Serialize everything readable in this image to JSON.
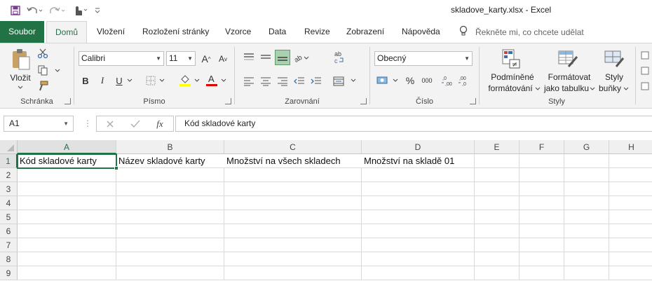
{
  "window": {
    "title": "skladove_karty.xlsx  -  Excel"
  },
  "colors": {
    "accent": "#217346"
  },
  "qat": {
    "icons": [
      "save-icon",
      "undo-icon",
      "redo-icon",
      "touch-mode-icon",
      "customize-qat-icon"
    ]
  },
  "tabs": [
    {
      "label": "Soubor"
    },
    {
      "label": "Domů"
    },
    {
      "label": "Vložení"
    },
    {
      "label": "Rozložení stránky"
    },
    {
      "label": "Vzorce"
    },
    {
      "label": "Data"
    },
    {
      "label": "Revize"
    },
    {
      "label": "Zobrazení"
    },
    {
      "label": "Nápověda"
    }
  ],
  "tellme": {
    "placeholder": "Řekněte mi, co chcete udělat"
  },
  "ribbon": {
    "clipboard": {
      "label": "Schránka",
      "paste_label": "Vložit"
    },
    "font": {
      "label": "Písmo",
      "font_name": "Calibri",
      "font_size": "11",
      "bold": "B",
      "italic": "I",
      "underline": "U"
    },
    "alignment": {
      "label": "Zarovnání"
    },
    "number": {
      "label": "Číslo",
      "format": "Obecný"
    },
    "styles": {
      "label": "Styly",
      "cond_format_line1": "Podmíněné",
      "cond_format_line2": "formátování",
      "format_table_line1": "Formátovat",
      "format_table_line2": "jako tabulku",
      "cell_styles_line1": "Styly",
      "cell_styles_line2": "buňky"
    }
  },
  "formula_bar": {
    "name_box": "A1",
    "fx": "fx",
    "content": "Kód skladové karty"
  },
  "sheet": {
    "columns": [
      "A",
      "B",
      "C",
      "D",
      "E",
      "F",
      "G",
      "H"
    ],
    "selected_column": "A",
    "rows": [
      "1",
      "2",
      "3",
      "4",
      "5",
      "6",
      "7",
      "8",
      "9"
    ],
    "active_cell": "A1",
    "row1": [
      "Kód skladové karty",
      "Název skladové karty",
      "Množství na všech skladech",
      "Množství na skladě 01"
    ]
  }
}
